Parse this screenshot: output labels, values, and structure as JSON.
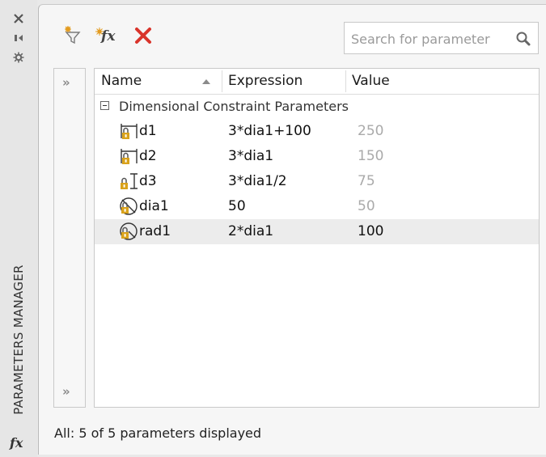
{
  "side": {
    "title": "PARAMETERS MANAGER",
    "icons": [
      "close-icon",
      "auto-hide-icon",
      "properties-icon",
      "fx-icon"
    ],
    "fx_glyph": "fx"
  },
  "toolbar": {
    "buttons": [
      "filter-icon",
      "new-user-parameter-icon",
      "delete-icon"
    ],
    "fx_glyph": "fx"
  },
  "search": {
    "placeholder": "Search for parameter",
    "value": ""
  },
  "rail": {
    "expand_top": "»",
    "expand_bottom": "»"
  },
  "table": {
    "columns": [
      "Name",
      "Expression",
      "Value"
    ],
    "sort_column": "Name",
    "group": {
      "label": "Dimensional Constraint Parameters",
      "expanded": true
    },
    "rows": [
      {
        "icon": "linear-dimension-icon",
        "name": "d1",
        "expression": "3*dia1+100",
        "value": "250"
      },
      {
        "icon": "linear-dimension-icon",
        "name": "d2",
        "expression": "3*dia1",
        "value": "150"
      },
      {
        "icon": "vertical-dimension-icon",
        "name": "d3",
        "expression": "3*dia1/2",
        "value": "75"
      },
      {
        "icon": "diameter-dimension-icon",
        "name": "dia1",
        "expression": "50",
        "value": "50"
      },
      {
        "icon": "radius-dimension-icon",
        "name": "rad1",
        "expression": "2*dia1",
        "value": "100"
      }
    ]
  },
  "status": "All: 5 of 5 parameters displayed",
  "colors": {
    "lock": "#d9a21c",
    "delete": "#d9342b",
    "filter_accent": "#e39b1f"
  }
}
